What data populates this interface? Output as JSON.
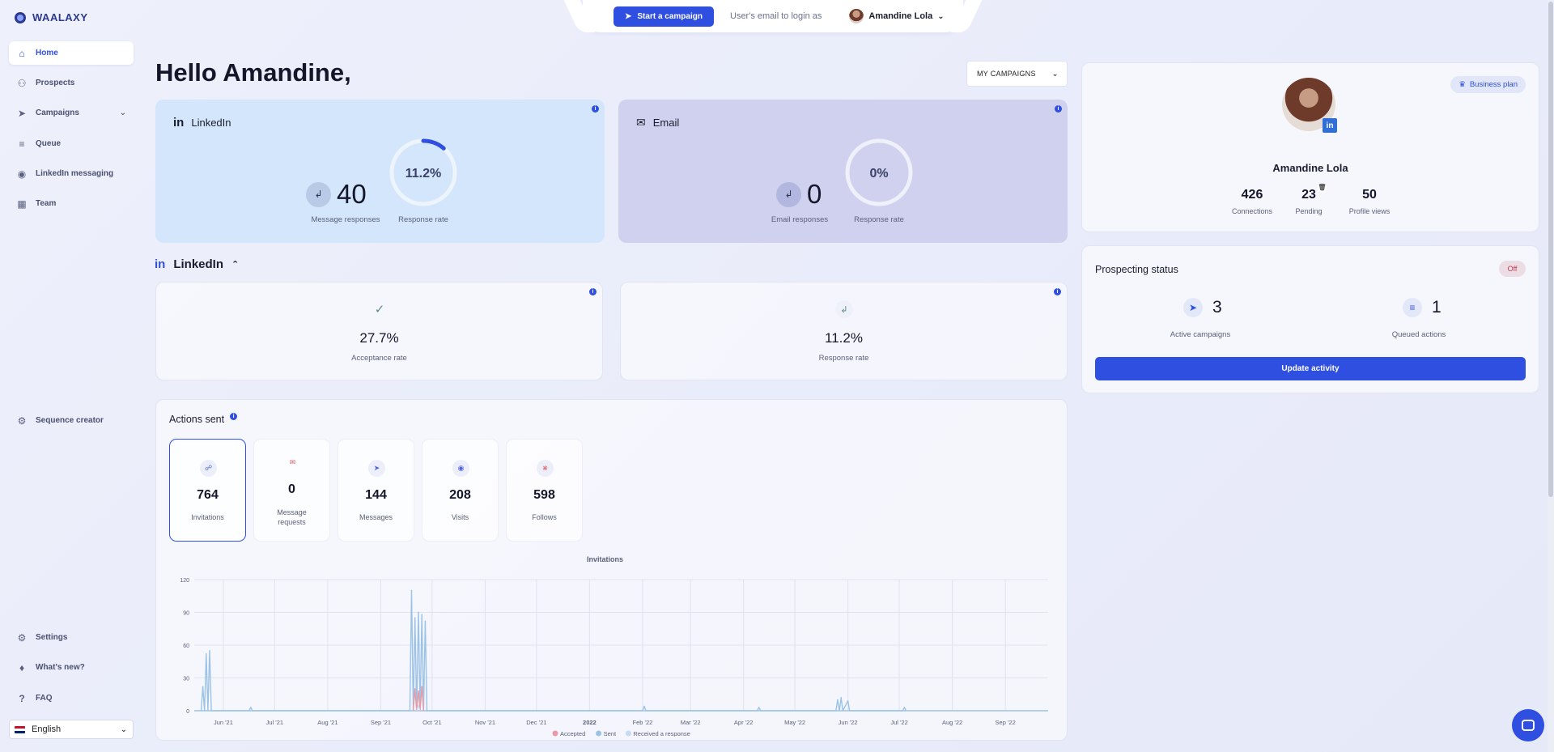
{
  "app": {
    "logo": "WAALAXY"
  },
  "sidebar": {
    "items": [
      {
        "label": "Home",
        "icon": "home-icon"
      },
      {
        "label": "Prospects",
        "icon": "users-icon"
      },
      {
        "label": "Campaigns",
        "icon": "rocket-icon"
      },
      {
        "label": "Queue",
        "icon": "queue-icon"
      },
      {
        "label": "LinkedIn messaging",
        "icon": "chat-icon"
      },
      {
        "label": "Team",
        "icon": "team-icon"
      },
      {
        "label": "Sequence creator",
        "icon": "gear-icon"
      },
      {
        "label": "Settings",
        "icon": "gear-icon"
      },
      {
        "label": "What's new?",
        "icon": "bell-icon"
      },
      {
        "label": "FAQ",
        "icon": "question-icon"
      }
    ],
    "language": "English"
  },
  "topbar": {
    "start_campaign": "Start a campaign",
    "login_hint": "User's email to login as",
    "user_name": "Amandine Lola"
  },
  "main": {
    "greeting": "Hello Amandine,",
    "campaign_select": "MY CAMPAIGNS",
    "linkedin_card": {
      "title": "LinkedIn",
      "responses": "40",
      "responses_label": "Message responses",
      "rate": "11.2%",
      "rate_value": 11.2,
      "rate_label": "Response rate"
    },
    "email_card": {
      "title": "Email",
      "responses": "0",
      "responses_label": "Email responses",
      "rate": "0%",
      "rate_value": 0,
      "rate_label": "Response rate"
    },
    "linkedin_section": {
      "title": "LinkedIn",
      "acceptance": {
        "value": "27.7%",
        "label": "Acceptance rate"
      },
      "response": {
        "value": "11.2%",
        "label": "Response rate"
      }
    },
    "actions": {
      "title": "Actions sent",
      "items": [
        {
          "value": "764",
          "label": "Invitations",
          "icon": "link-icon",
          "color": "#4b63d8"
        },
        {
          "value": "0",
          "label": "Message requests",
          "icon": "envelope-icon",
          "color": "#e06070"
        },
        {
          "value": "144",
          "label": "Messages",
          "icon": "send-icon",
          "color": "#4b63d8"
        },
        {
          "value": "208",
          "label": "Visits",
          "icon": "eye-icon",
          "color": "#4b63d8"
        },
        {
          "value": "598",
          "label": "Follows",
          "icon": "rss-icon",
          "color": "#e06070"
        }
      ]
    }
  },
  "profile": {
    "plan": "Business plan",
    "name": "Amandine Lola",
    "stats": [
      {
        "value": "426",
        "label": "Connections"
      },
      {
        "value": "23",
        "label": "Pending"
      },
      {
        "value": "50",
        "label": "Profile views"
      }
    ]
  },
  "prospecting": {
    "title": "Prospecting status",
    "status": "Off",
    "active_campaigns": {
      "value": "3",
      "label": "Active campaigns"
    },
    "queued_actions": {
      "value": "1",
      "label": "Queued actions"
    },
    "update_button": "Update activity"
  },
  "chart_data": {
    "type": "area",
    "title": "Invitations",
    "ylim": [
      0,
      120
    ],
    "yticks": [
      0,
      30,
      60,
      90,
      120
    ],
    "xticks": [
      "Jun '21",
      "Jul '21",
      "Aug '21",
      "Sep '21",
      "Oct '21",
      "Nov '21",
      "Dec '21",
      "2022",
      "Feb '22",
      "Mar '22",
      "Apr '22",
      "May '22",
      "Jun '22",
      "Jul '22",
      "Aug '22",
      "Sep '22"
    ],
    "grid": true,
    "legend_position": "bottom",
    "series": [
      {
        "name": "Accepted",
        "color": "#e89aa6",
        "points": [
          [
            "Sep 20 '21",
            0
          ],
          [
            "Sep 21 '21",
            20
          ],
          [
            "Sep 22 '21",
            0
          ],
          [
            "Sep 23 '21",
            18
          ],
          [
            "Sep 24 '21",
            0
          ],
          [
            "Sep 25 '21",
            22
          ],
          [
            "Sep 26 '21",
            0
          ]
        ]
      },
      {
        "name": "Sent",
        "color": "#9cc3e6",
        "points": [
          [
            "May 19 '21",
            0
          ],
          [
            "May 20 '21",
            22
          ],
          [
            "May 21 '21",
            0
          ],
          [
            "May 22 '21",
            52
          ],
          [
            "May 23 '21",
            0
          ],
          [
            "May 24 '21",
            55
          ],
          [
            "May 25 '21",
            0
          ],
          [
            "Jun 16 '21",
            0
          ],
          [
            "Jun 17 '21",
            3
          ],
          [
            "Jun 18 '21",
            0
          ],
          [
            "Sep 18 '21",
            0
          ],
          [
            "Sep 19 '21",
            110
          ],
          [
            "Sep 20 '21",
            0
          ],
          [
            "Sep 21 '21",
            85
          ],
          [
            "Sep 22 '21",
            0
          ],
          [
            "Sep 23 '21",
            90
          ],
          [
            "Sep 24 '21",
            0
          ],
          [
            "Sep 25 '21",
            88
          ],
          [
            "Sep 26 '21",
            0
          ],
          [
            "Sep 27 '21",
            82
          ],
          [
            "Sep 28 '21",
            0
          ],
          [
            "Feb 1 '22",
            0
          ],
          [
            "Feb 2 '22",
            4
          ],
          [
            "Feb 3 '22",
            0
          ],
          [
            "Apr 9 '22",
            0
          ],
          [
            "Apr 10 '22",
            3
          ],
          [
            "Apr 11 '22",
            0
          ],
          [
            "May 25 '22",
            0
          ],
          [
            "May 26 '22",
            10
          ],
          [
            "May 27 '22",
            0
          ],
          [
            "May 28 '22",
            12
          ],
          [
            "May 29 '22",
            0
          ],
          [
            "Jun 1 '22",
            9
          ],
          [
            "Jun 2 '22",
            0
          ],
          [
            "Jul 3 '22",
            0
          ],
          [
            "Jul 4 '22",
            3
          ],
          [
            "Jul 5 '22",
            0
          ]
        ]
      },
      {
        "name": "Received a response",
        "color": "#c7dbef",
        "points": [
          [
            "Sep 22 '21",
            0
          ],
          [
            "Sep 23 '21",
            5
          ],
          [
            "Sep 24 '21",
            0
          ]
        ]
      }
    ]
  }
}
